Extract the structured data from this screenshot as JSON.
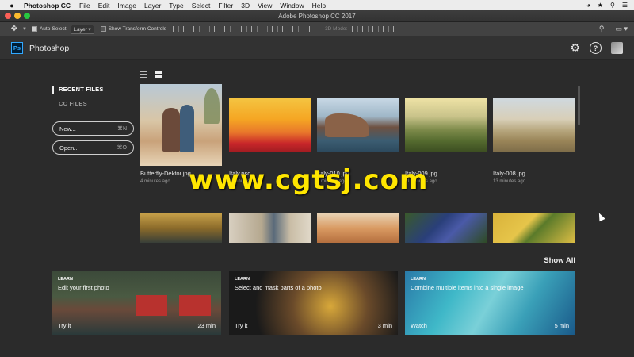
{
  "menubar": {
    "app_name": "Photoshop CC",
    "items": [
      "File",
      "Edit",
      "Image",
      "Layer",
      "Type",
      "Select",
      "Filter",
      "3D",
      "View",
      "Window",
      "Help"
    ]
  },
  "window": {
    "title": "Adobe Photoshop CC 2017"
  },
  "options_bar": {
    "auto_select_label": "Auto-Select:",
    "auto_select_value": "Layer",
    "transform_controls_label": "Show Transform Controls",
    "mode_3d_label": "3D Mode:"
  },
  "header": {
    "product_name": "Photoshop",
    "logo_text": "Ps"
  },
  "nav": {
    "recent_files": "RECENT FILES",
    "cc_files": "CC FILES",
    "new_label": "New...",
    "new_shortcut": "⌘N",
    "open_label": "Open...",
    "open_shortcut": "⌘O"
  },
  "files": [
    {
      "name": "Butterfly-Dektor.jpg",
      "time": "4 minutes ago"
    },
    {
      "name": "Italy.psd",
      "time": "4 minutes ago"
    },
    {
      "name": "Italy-010.jpg",
      "time": "7 minutes ago"
    },
    {
      "name": "Italy-009.jpg",
      "time": "11 minutes ago"
    },
    {
      "name": "Italy-008.jpg",
      "time": "13 minutes ago"
    }
  ],
  "watermark": "www.cgtsj.com",
  "learn": {
    "show_all": "Show All",
    "cards": [
      {
        "tag": "LEARN",
        "title": "Edit your first photo",
        "action": "Try it",
        "duration": "23 min"
      },
      {
        "tag": "LEARN",
        "title": "Select and mask parts of a photo",
        "action": "Try it",
        "duration": "3 min"
      },
      {
        "tag": "LEARN",
        "title": "Combine multiple items into a single image",
        "action": "Watch",
        "duration": "5 min"
      }
    ]
  },
  "colors": {
    "accent": "#31a8ff",
    "background": "#2b2b2b",
    "watermark": "#ffe600"
  }
}
